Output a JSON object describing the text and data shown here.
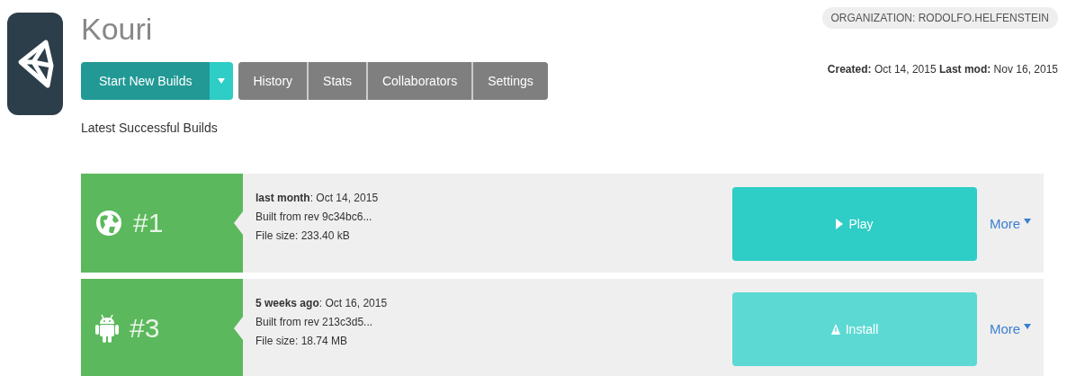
{
  "project": {
    "title": "Kouri",
    "organization": "ORGANIZATION: RODOLFO.HELFENSTEIN",
    "dates": "**Created:** Oct 14, 2015 **Last mod:** Nov 16, 2015"
  },
  "toolbar": {
    "primary": "Start New Builds",
    "tabs": [
      {
        "label": "History"
      },
      {
        "label": "Stats"
      },
      {
        "label": "Collaborators"
      },
      {
        "label": "Settings"
      }
    ]
  },
  "section_title": "Latest Successful Builds",
  "builds": [
    {
      "kind": "web",
      "number": "#1",
      "when": "**last month**: Oct 14, 2015",
      "revision": "Built from rev 9c34bc6...",
      "size": "File size: 233.40 kB",
      "action": {
        "kind": "play",
        "label": "Play"
      },
      "more": "More"
    },
    {
      "kind": "android",
      "number": "#3",
      "when": "**5 weeks ago**: Oct 16, 2015",
      "revision": "Built from rev 213c3d5...",
      "size": "File size: 18.74 MB",
      "action": {
        "kind": "install",
        "label": "Install"
      },
      "more": "More"
    }
  ]
}
